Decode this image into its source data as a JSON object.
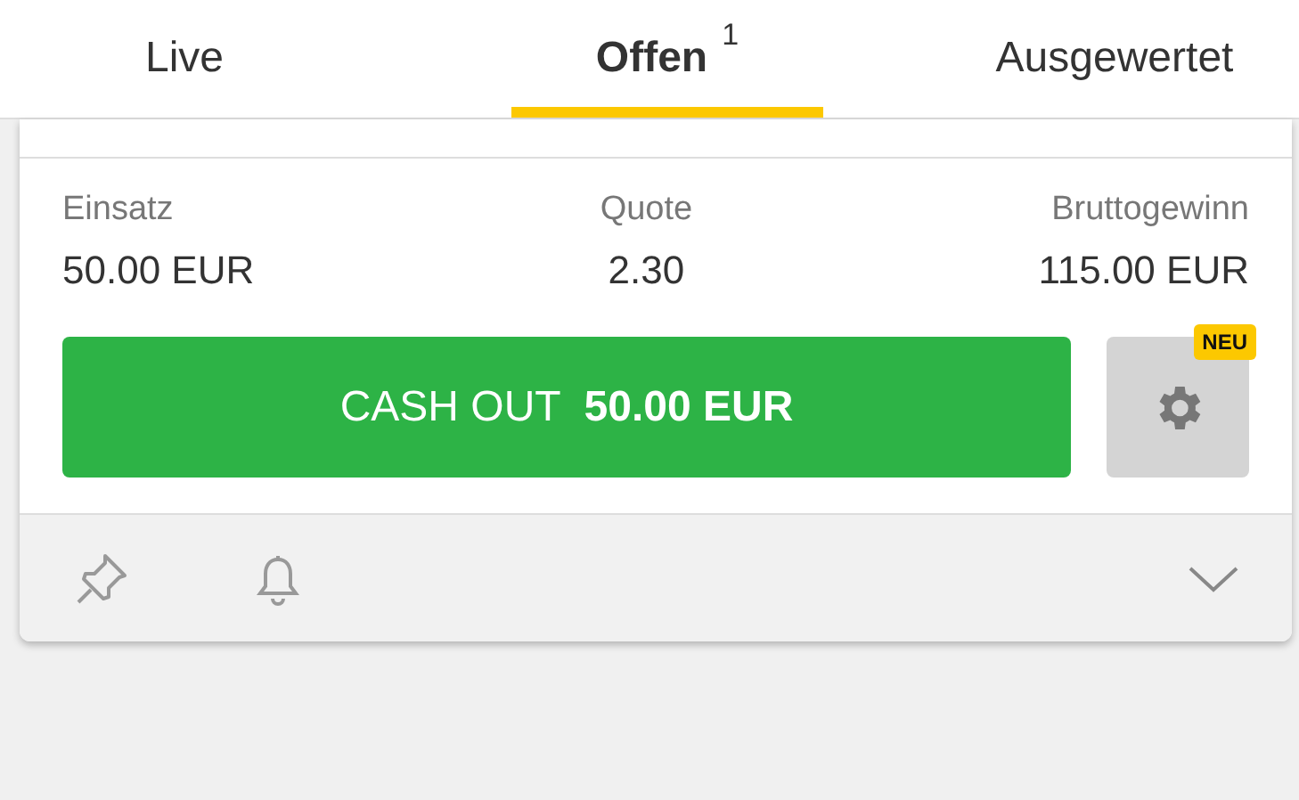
{
  "tabs": [
    {
      "label": "Live",
      "selected": false
    },
    {
      "label": "Offen",
      "count": "1",
      "selected": true
    },
    {
      "label": "Ausgewertet",
      "selected": false
    }
  ],
  "bet": {
    "stats": [
      {
        "label": "Einsatz",
        "value": "50.00 EUR"
      },
      {
        "label": "Quote",
        "value": "2.30"
      },
      {
        "label": "Bruttogewinn",
        "value": "115.00 EUR"
      }
    ],
    "cashout": "CASH OUT  **50.00 EUR**",
    "settings_badge": "NEU"
  }
}
